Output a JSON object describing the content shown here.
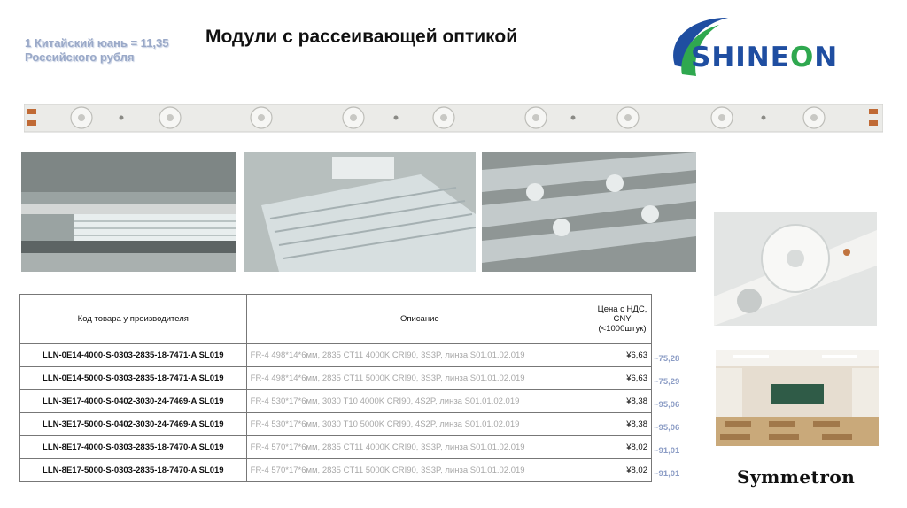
{
  "slide": {
    "title": "Модули с рассеивающей оптикой",
    "exchange_rate": "1 Китайский юань = 11,35 Российского рубля",
    "logo_top": {
      "part1": "SHINE",
      "part2": "O",
      "part3": "N"
    },
    "logo_bottom": "Symmetron"
  },
  "table": {
    "headers": {
      "code": "Код товара у производителя",
      "description": "Описание",
      "price": "Цена с НДС, CNY (<1000штук)"
    },
    "rows": [
      {
        "code": "LLN-0E14-4000-S-0303-2835-18-7471-A SL019",
        "description": "FR-4 498*14*6мм, 2835 CT11 4000K CRI90, 3S3P, линза S01.01.02.019",
        "price": "¥6,63",
        "rub": "~75,28"
      },
      {
        "code": "LLN-0E14-5000-S-0303-2835-18-7471-A SL019",
        "description": "FR-4 498*14*6мм, 2835 CT11 5000K CRI90, 3S3P, линза S01.01.02.019",
        "price": "¥6,63",
        "rub": "~75,29"
      },
      {
        "code": "LLN-3E17-4000-S-0402-3030-24-7469-A SL019",
        "description": "FR-4 530*17*6мм, 3030 T10 4000K CRI90, 4S2P, линза S01.01.02.019",
        "price": "¥8,38",
        "rub": "~95,06"
      },
      {
        "code": "LLN-3E17-5000-S-0402-3030-24-7469-A SL019",
        "description": "FR-4 530*17*6мм, 3030 T10 5000K CRI90, 4S2P, линза S01.01.02.019",
        "price": "¥8,38",
        "rub": "~95,06"
      },
      {
        "code": "LLN-8E17-4000-S-0303-2835-18-7470-A SL019",
        "description": "FR-4 570*17*6мм, 2835 CT11 4000K CRI90, 3S3P, линза S01.01.02.019",
        "price": "¥8,02",
        "rub": "~91,01"
      },
      {
        "code": "LLN-8E17-5000-S-0303-2835-18-7470-A SL019",
        "description": "FR-4 570*17*6мм, 2835 CT11 5000K CRI90, 3S3P, линза S01.01.02.019",
        "price": "¥8,02",
        "rub": "~91,01"
      }
    ]
  },
  "colors": {
    "logo_blue": "#1f4ea1",
    "logo_green": "#2fa84f",
    "rub_text": "#8b9cc5"
  }
}
